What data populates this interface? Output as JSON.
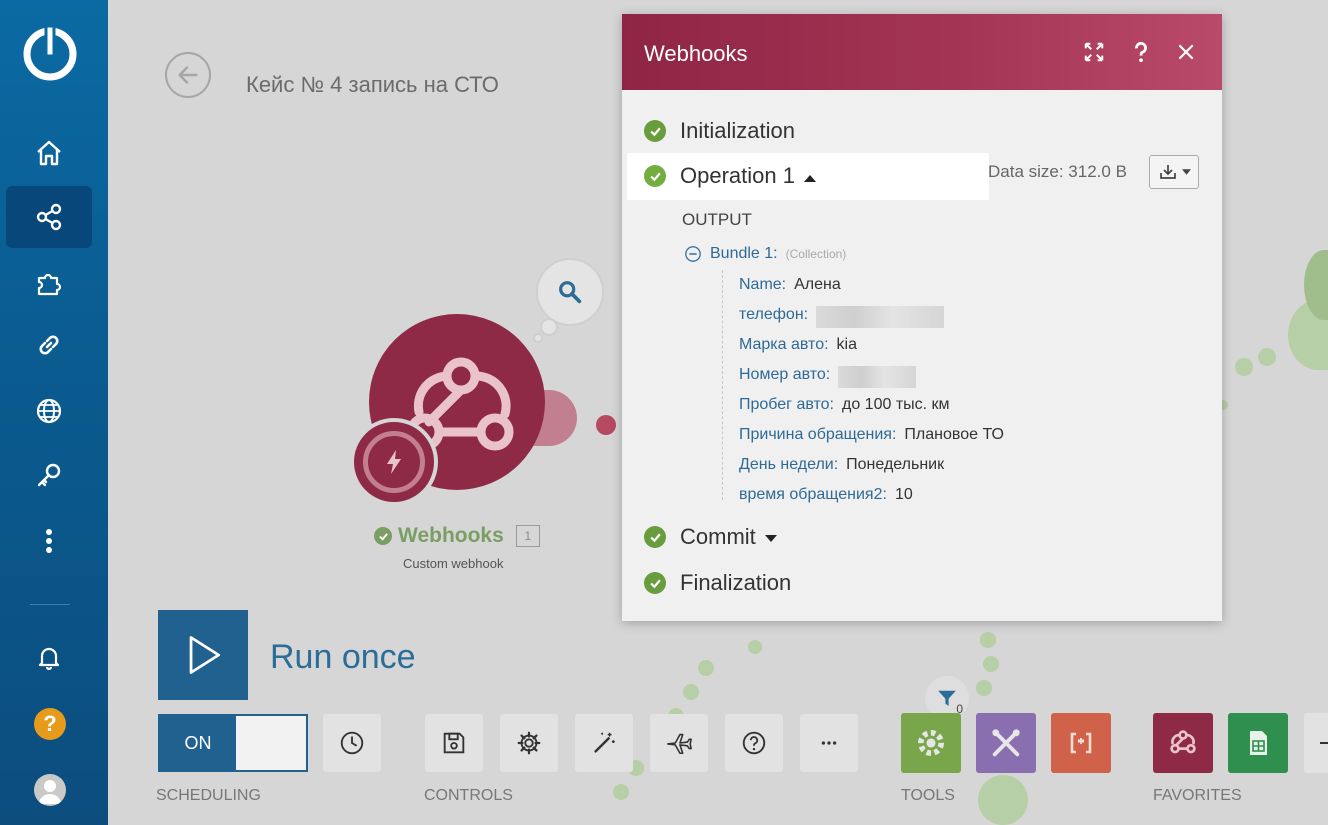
{
  "scenario": {
    "title": "Кейс № 4 запись на СТО"
  },
  "module": {
    "name": "Webhooks",
    "subtitle": "Custom webhook",
    "run_count": "1"
  },
  "run": {
    "label": "Run once"
  },
  "scheduling": {
    "toggle": "ON",
    "label": "SCHEDULING"
  },
  "controls": {
    "label": "CONTROLS"
  },
  "tools": {
    "label": "TOOLS"
  },
  "favorites": {
    "label": "FAVORITES"
  },
  "filter": {
    "count": "0"
  },
  "panel": {
    "title": "Webhooks",
    "steps": {
      "initialization": "Initialization",
      "operation": "Operation 1",
      "commit": "Commit",
      "finalization": "Finalization"
    },
    "data_size": "Data size: 312.0 B",
    "output_label": "OUTPUT",
    "bundle": {
      "label": "Bundle 1:",
      "type": "(Collection)"
    },
    "fields": [
      {
        "key": "Name:",
        "value": "Алена"
      },
      {
        "key": "телефон:",
        "value": ""
      },
      {
        "key": "Марка авто:",
        "value": "kia"
      },
      {
        "key": "Номер авто:",
        "value": ""
      },
      {
        "key": "Пробег авто:",
        "value": "до 100 тыс. км"
      },
      {
        "key": "Причина обращения:",
        "value": "Плановое ТО"
      },
      {
        "key": "День недели:",
        "value": "Понедельник"
      },
      {
        "key": "время обращения2:",
        "value": "10"
      }
    ]
  },
  "colors": {
    "sidebar": "#0b6aa3",
    "panel_header": "#a33454",
    "success_green": "#689c3d",
    "run_button": "#21618f"
  }
}
